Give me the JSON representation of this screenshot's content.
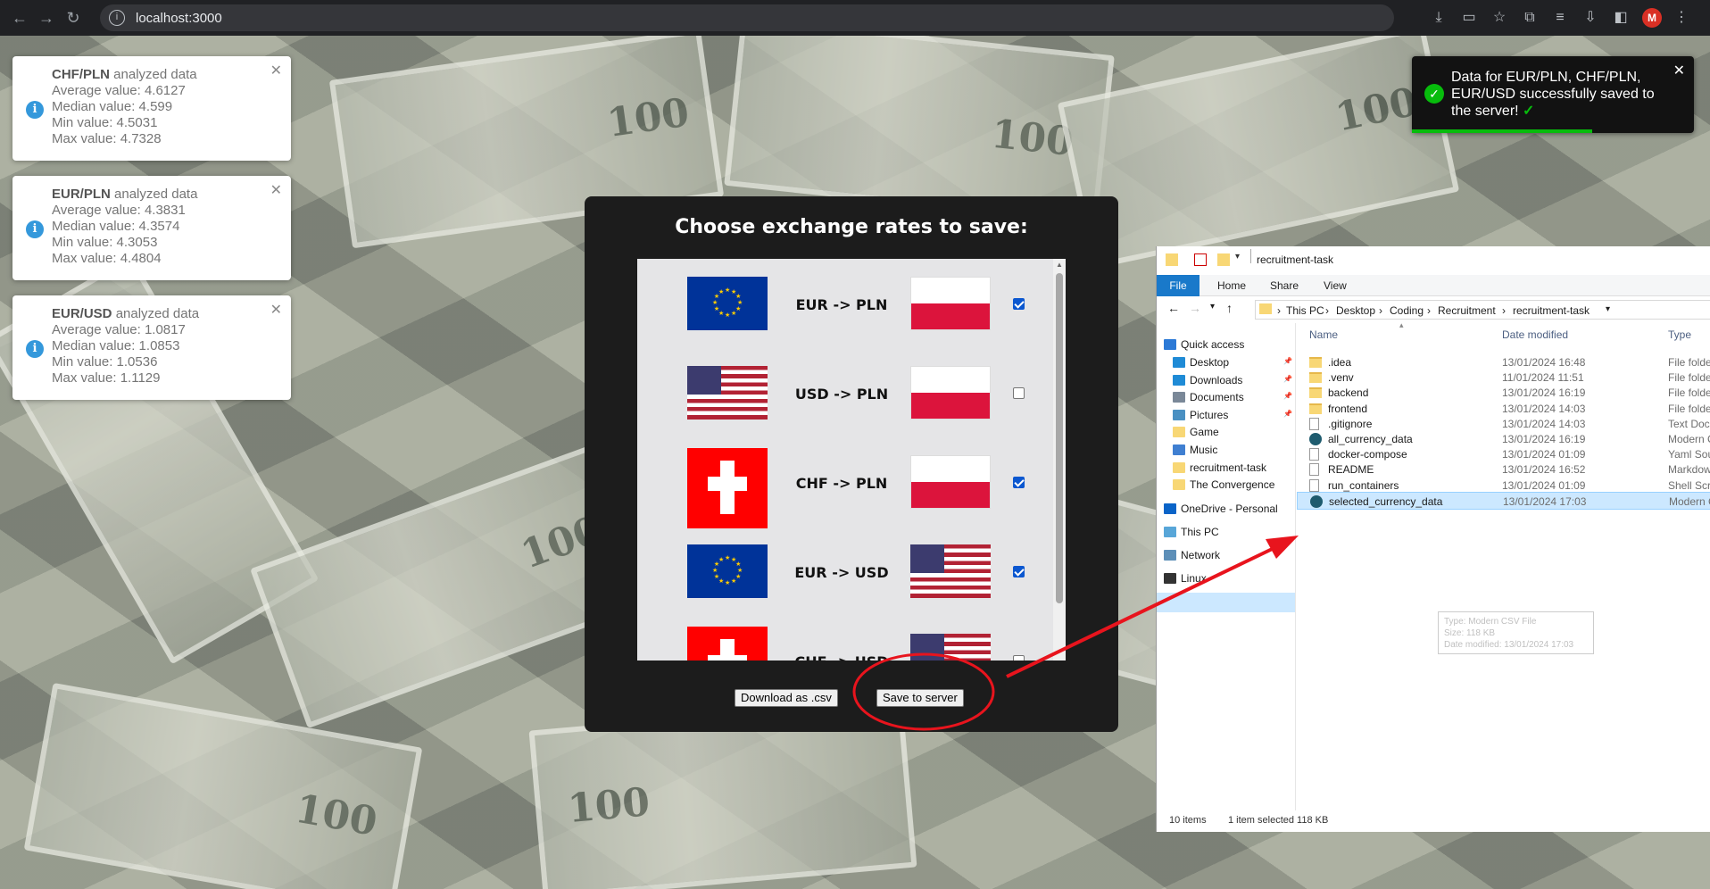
{
  "browser": {
    "url": "localhost:3000",
    "avatar_letter": "M"
  },
  "analysis_cards": [
    {
      "pair": "CHF/PLN",
      "suffix": "analyzed data",
      "average": "Average value: 4.6127",
      "median": "Median value: 4.599",
      "min": "Min value: 4.5031",
      "max": "Max value: 4.7328"
    },
    {
      "pair": "EUR/PLN",
      "suffix": "analyzed data",
      "average": "Average value: 4.3831",
      "median": "Median value: 4.3574",
      "min": "Min value: 4.3053",
      "max": "Max value: 4.4804"
    },
    {
      "pair": "EUR/USD",
      "suffix": "analyzed data",
      "average": "Average value: 1.0817",
      "median": "Median value: 1.0853",
      "min": "Min value: 1.0536",
      "max": "Max value: 1.1129"
    }
  ],
  "success_toast": {
    "message": "Data for EUR/PLN, CHF/PLN, EUR/USD successfully saved to the server!",
    "check": "✓",
    "progress_fraction": 0.64
  },
  "modal": {
    "title": "Choose exchange rates to save:",
    "rows": [
      {
        "label": "EUR -> PLN",
        "from": "eu",
        "to": "pl",
        "checked": true
      },
      {
        "label": "USD -> PLN",
        "from": "us",
        "to": "pl",
        "checked": false
      },
      {
        "label": "CHF -> PLN",
        "from": "ch",
        "to": "pl",
        "checked": true
      },
      {
        "label": "EUR -> USD",
        "from": "eu",
        "to": "us",
        "checked": true
      },
      {
        "label": "CHF -> USD",
        "from": "ch",
        "to": "us",
        "checked": false
      }
    ],
    "download_button": "Download as .csv",
    "save_button": "Save to server"
  },
  "explorer": {
    "window_title": "recruitment-task",
    "ribbon_tabs": [
      "File",
      "Home",
      "Share",
      "View"
    ],
    "breadcrumbs": [
      "This PC",
      "Desktop",
      "Coding",
      "Recruitment",
      "recruitment-task"
    ],
    "sidebar": [
      {
        "label": "Quick access",
        "icon": "star-icon",
        "pinned": false
      },
      {
        "label": "Desktop",
        "icon": "desktop-icon",
        "pinned": true
      },
      {
        "label": "Downloads",
        "icon": "download-icon",
        "pinned": true
      },
      {
        "label": "Documents",
        "icon": "documents-icon",
        "pinned": true
      },
      {
        "label": "Pictures",
        "icon": "pictures-icon",
        "pinned": true
      },
      {
        "label": "Game",
        "icon": "folder-icon",
        "pinned": false
      },
      {
        "label": "Music",
        "icon": "music-icon",
        "pinned": false
      },
      {
        "label": "recruitment-task",
        "icon": "folder-icon",
        "pinned": false
      },
      {
        "label": "The Convergence",
        "icon": "folder-icon",
        "pinned": false
      },
      {
        "label": "OneDrive - Personal",
        "icon": "cloud-icon",
        "pinned": false
      },
      {
        "label": "This PC",
        "icon": "pc-icon",
        "pinned": false
      },
      {
        "label": "Network",
        "icon": "network-icon",
        "pinned": false
      },
      {
        "label": "Linux",
        "icon": "linux-icon",
        "pinned": false
      }
    ],
    "columns": {
      "name": "Name",
      "date": "Date modified",
      "type": "Type"
    },
    "files": [
      {
        "name": ".idea",
        "date": "13/01/2024 16:48",
        "type": "File folder",
        "kind": "folder"
      },
      {
        "name": ".venv",
        "date": "11/01/2024 11:51",
        "type": "File folder",
        "kind": "folder"
      },
      {
        "name": "backend",
        "date": "13/01/2024 16:19",
        "type": "File folder",
        "kind": "folder"
      },
      {
        "name": "frontend",
        "date": "13/01/2024 14:03",
        "type": "File folder",
        "kind": "folder"
      },
      {
        "name": ".gitignore",
        "date": "13/01/2024 14:03",
        "type": "Text Document",
        "kind": "doc"
      },
      {
        "name": "all_currency_data",
        "date": "13/01/2024 16:19",
        "type": "Modern CSV File",
        "kind": "csv"
      },
      {
        "name": "docker-compose",
        "date": "13/01/2024 01:09",
        "type": "Yaml Source File",
        "kind": "doc"
      },
      {
        "name": "README",
        "date": "13/01/2024 16:52",
        "type": "Markdown File",
        "kind": "doc"
      },
      {
        "name": "run_containers",
        "date": "13/01/2024 01:09",
        "type": "Shell Script",
        "kind": "doc"
      },
      {
        "name": "selected_currency_data",
        "date": "13/01/2024 17:03",
        "type": "Modern CSV File",
        "kind": "csv",
        "selected": true
      }
    ],
    "tooltip": [
      "Type: Modern CSV File",
      "Size: 118 KB",
      "Date modified: 13/01/2024 17:03"
    ],
    "status": {
      "count": "10 items",
      "selection": "1 item selected  118 KB"
    }
  }
}
